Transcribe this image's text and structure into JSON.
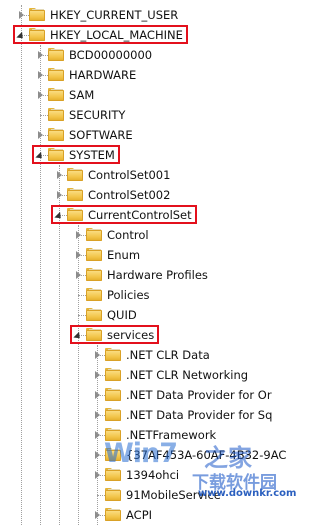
{
  "tree": {
    "items": [
      {
        "label": "HKEY_CURRENT_USER",
        "state": "collapsed",
        "level": 0
      },
      {
        "label": "HKEY_LOCAL_MACHINE",
        "state": "expanded",
        "level": 0,
        "highlighted": true
      },
      {
        "label": "BCD00000000",
        "state": "collapsed",
        "level": 1
      },
      {
        "label": "HARDWARE",
        "state": "collapsed",
        "level": 1
      },
      {
        "label": "SAM",
        "state": "collapsed",
        "level": 1
      },
      {
        "label": "SECURITY",
        "state": "none",
        "level": 1
      },
      {
        "label": "SOFTWARE",
        "state": "collapsed",
        "level": 1
      },
      {
        "label": "SYSTEM",
        "state": "expanded",
        "level": 1,
        "highlighted": true
      },
      {
        "label": "ControlSet001",
        "state": "collapsed",
        "level": 2
      },
      {
        "label": "ControlSet002",
        "state": "collapsed",
        "level": 2
      },
      {
        "label": "CurrentControlSet",
        "state": "expanded",
        "level": 2,
        "highlighted": true
      },
      {
        "label": "Control",
        "state": "collapsed",
        "level": 3
      },
      {
        "label": "Enum",
        "state": "collapsed",
        "level": 3
      },
      {
        "label": "Hardware Profiles",
        "state": "collapsed",
        "level": 3
      },
      {
        "label": "Policies",
        "state": "none",
        "level": 3
      },
      {
        "label": "QUID",
        "state": "none",
        "level": 3
      },
      {
        "label": "services",
        "state": "expanded",
        "level": 3,
        "highlighted": true
      },
      {
        "label": ".NET CLR Data",
        "state": "collapsed",
        "level": 4
      },
      {
        "label": ".NET CLR Networking",
        "state": "collapsed",
        "level": 4
      },
      {
        "label": ".NET Data Provider for Or",
        "state": "collapsed",
        "level": 4
      },
      {
        "label": ".NET Data Provider for Sq",
        "state": "collapsed",
        "level": 4
      },
      {
        "label": ".NETFramework",
        "state": "collapsed",
        "level": 4
      },
      {
        "label": "{37AF453A-60AF-4B32-9AC",
        "state": "collapsed",
        "level": 4
      },
      {
        "label": "1394ohci",
        "state": "collapsed",
        "level": 4
      },
      {
        "label": "91MobileService",
        "state": "none",
        "level": 4
      },
      {
        "label": "ACPI",
        "state": "collapsed",
        "level": 4
      }
    ]
  },
  "watermark": {
    "logo": "Win7",
    "brand": "之家",
    "tagline": "下载软件园",
    "site": "www.downkr.com"
  },
  "colors": {
    "highlight": "#e3101c",
    "folder": "#f3c64b",
    "tree_line": "#a0a0a0"
  }
}
